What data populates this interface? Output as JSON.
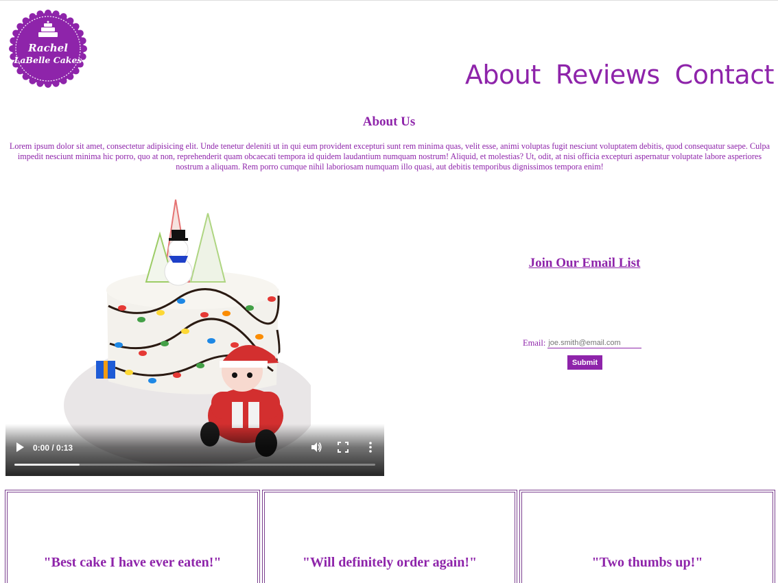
{
  "brand": {
    "logo_line1": "Rachel",
    "logo_line2": "LaBelle Cakes",
    "color": "#8e24aa",
    "logo_bg": "#8e24aa"
  },
  "nav": {
    "items": [
      {
        "label": "About"
      },
      {
        "label": "Reviews"
      },
      {
        "label": "Contact"
      }
    ]
  },
  "about": {
    "title": "About Us",
    "text": "Lorem ipsum dolor sit amet, consectetur adipisicing elit. Unde tenetur deleniti ut in qui eum provident excepturi sunt rem minima quas, velit esse, animi voluptas fugit nesciunt voluptatem debitis, quod consequatur saepe. Culpa impedit nesciunt minima hic porro, quo at non, reprehenderit quam obcaecati tempora id quidem laudantium numquam nostrum! Aliquid, et molestias? Ut, odit, at nisi officia excepturi aspernatur voluptate labore asperiores nostrum a aliquam. Rem porro cumque nihil laboriosam numquam illo quasi, aut debitis temporibus dignissimos tempora enim!"
  },
  "video": {
    "time": "0:00 / 0:13",
    "progress_fraction": 0.18,
    "icons": [
      "play-icon",
      "volume-icon",
      "fullscreen-icon",
      "more-options-icon"
    ]
  },
  "email": {
    "title": "Join Our Email List",
    "label": "Email:",
    "placeholder": "joe.smith@email.com",
    "submit_label": "Submit"
  },
  "reviews": [
    {
      "quote": "\"Best cake I have ever eaten!\""
    },
    {
      "quote": "\"Will definitely order again!\""
    },
    {
      "quote": "\"Two thumbs up!\""
    }
  ]
}
